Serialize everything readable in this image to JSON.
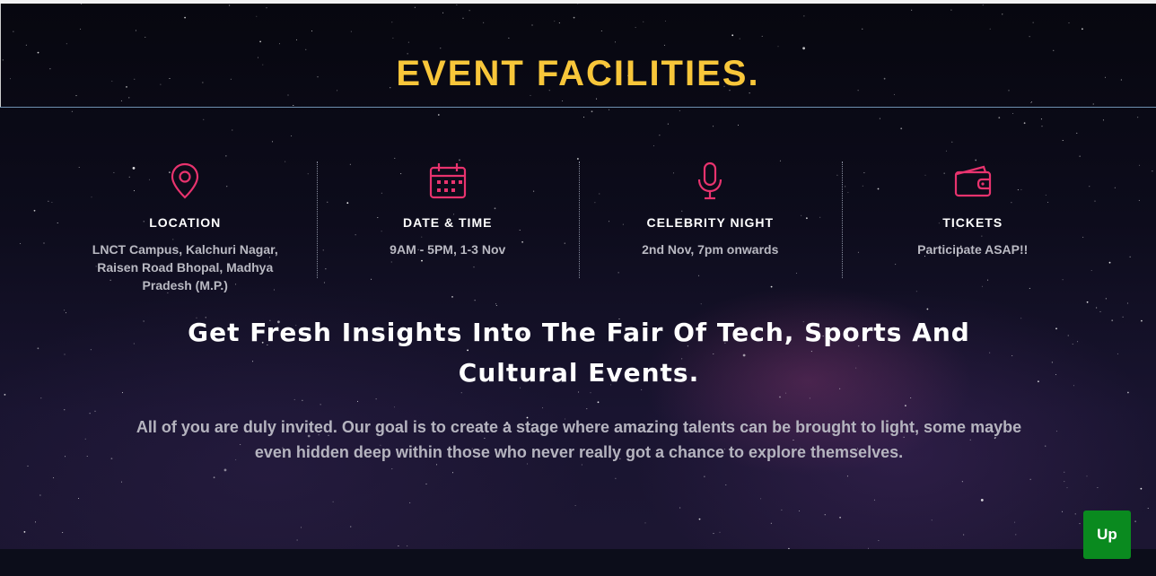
{
  "section": {
    "title": "EVENT FACILITIES."
  },
  "facilities": [
    {
      "icon": "location-pin-icon",
      "title": "LOCATION",
      "text": "LNCT Campus, Kalchuri Nagar, Raisen Road Bhopal, Madhya Pradesh (M.P.)"
    },
    {
      "icon": "calendar-icon",
      "title": "DATE & TIME",
      "text": "9AM - 5PM, 1-3 Nov"
    },
    {
      "icon": "microphone-icon",
      "title": "CELEBRITY NIGHT",
      "text": "2nd Nov, 7pm onwards"
    },
    {
      "icon": "wallet-icon",
      "title": "TICKETS",
      "text": "Participate ASAP!!"
    }
  ],
  "headline": "Get Fresh Insights Into The Fair Of Tech, Sports And Cultural Events.",
  "intro": "All of you are duly invited. Our goal is to create a stage where amazing talents can be brought to light, some maybe even hidden deep within those who never really got a chance to explore themselves.",
  "scroll_up_label": "Up",
  "colors": {
    "title": "#f8c63a",
    "icon": "#e8336e",
    "up_button": "#0a8a1f"
  }
}
